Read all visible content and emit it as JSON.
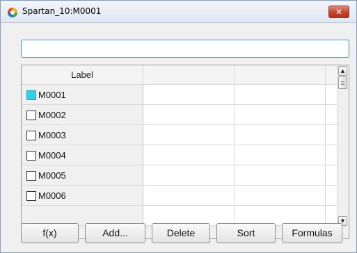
{
  "window": {
    "title": "Spartan_10:M0001",
    "close_label": "✕",
    "close_color": "#c5442c"
  },
  "search": {
    "value": "",
    "placeholder": ""
  },
  "grid": {
    "columns": [
      {
        "label": "Label"
      },
      {
        "label": ""
      },
      {
        "label": ""
      },
      {
        "label": ""
      }
    ],
    "rows": [
      {
        "label": "M0001",
        "selected": true,
        "cells": [
          "",
          "",
          ""
        ]
      },
      {
        "label": "M0002",
        "selected": false,
        "cells": [
          "",
          "",
          ""
        ]
      },
      {
        "label": "M0003",
        "selected": false,
        "cells": [
          "",
          "",
          ""
        ]
      },
      {
        "label": "M0004",
        "selected": false,
        "cells": [
          "",
          "",
          ""
        ]
      },
      {
        "label": "M0005",
        "selected": false,
        "cells": [
          "",
          "",
          ""
        ]
      },
      {
        "label": "M0006",
        "selected": false,
        "cells": [
          "",
          "",
          ""
        ]
      }
    ],
    "selected_color": "#2fd0e8"
  },
  "buttons": {
    "fx": "f(x)",
    "add": "Add...",
    "delete": "Delete",
    "sort": "Sort",
    "formulas": "Formulas"
  },
  "icons": {
    "app": "spartan-app-icon",
    "close": "close-icon",
    "scroll_up": "arrow-up-icon",
    "scroll_down": "arrow-down-icon",
    "scroll_left": "arrow-left-icon",
    "scroll_right": "arrow-right-icon"
  }
}
